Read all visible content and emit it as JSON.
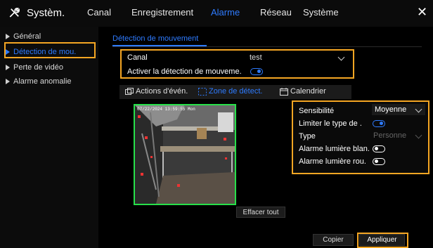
{
  "header": {
    "brand": "Systèm.",
    "tabs": [
      {
        "label": "Canal"
      },
      {
        "label": "Enregistrement"
      },
      {
        "label": "Alarme"
      },
      {
        "label": "Réseau"
      },
      {
        "label": "Système"
      }
    ],
    "close_glyph": "✕",
    "accent": "#2e7bff"
  },
  "sidebar": {
    "items": [
      {
        "label": "Général"
      },
      {
        "label": "Détection de mou."
      },
      {
        "label": "Perte de vidéo"
      },
      {
        "label": "Alarme anomalie"
      }
    ]
  },
  "main": {
    "section_tab": "Détection de mouvement",
    "canal_label": "Canal",
    "canal_value": "test",
    "activer_label": "Activer la détection de mouveme.",
    "subtabs": [
      {
        "label": "Actions d'évén.",
        "icon": "actions-icon"
      },
      {
        "label": "Zone de détect.",
        "icon": "zone-icon"
      },
      {
        "label": "Calendrier",
        "icon": "calendar-icon"
      }
    ],
    "video_timestamp": "07/22/2024 13:59:55 Mon",
    "clear_all": "Effacer tout"
  },
  "settings": {
    "sensibilite_label": "Sensibilité",
    "sensibilite_value": "Moyenne",
    "limiter_label": "Limiter le type de .",
    "type_label": "Type",
    "type_value": "Personne",
    "white_light_label": "Alarme lumière blan.",
    "red_light_label": "Alarme lumière rou."
  },
  "footer": {
    "copy": "Copier",
    "apply": "Appliquer"
  },
  "colors": {
    "highlight": "#f5a623",
    "zone_border": "#27e04a"
  }
}
